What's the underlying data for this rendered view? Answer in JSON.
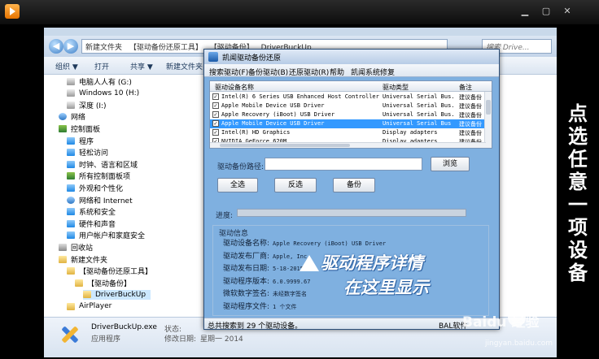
{
  "explorer": {
    "breadcrumb": [
      "新建文件夹",
      "【驱动备份还原工具】",
      "【驱动备份】",
      "DriverBuckUp"
    ],
    "search_placeholder": "搜索 Drive...",
    "toolbar": [
      "组织 ▼",
      "打开",
      "共享 ▼",
      "新建文件夹"
    ],
    "tree": [
      {
        "label": "电脑人人有 (G:)",
        "icon": "drive-icon",
        "indent": 1
      },
      {
        "label": "Windows 10 (H:)",
        "icon": "drive-icon",
        "indent": 1
      },
      {
        "label": "深度 (I:)",
        "icon": "drive-icon",
        "indent": 1
      },
      {
        "label": "网络",
        "icon": "network-icon",
        "indent": 0
      },
      {
        "label": "控制面板",
        "icon": "control-panel-icon",
        "indent": 0
      },
      {
        "label": "程序",
        "icon": "program-icon",
        "indent": 1
      },
      {
        "label": "轻松访问",
        "icon": "access-icon",
        "indent": 1
      },
      {
        "label": "时钟、语言和区域",
        "icon": "clock-icon",
        "indent": 1
      },
      {
        "label": "所有控制面板项",
        "icon": "control-panel-icon",
        "indent": 1
      },
      {
        "label": "外观和个性化",
        "icon": "appearance-icon",
        "indent": 1
      },
      {
        "label": "网络和 Internet",
        "icon": "network-icon",
        "indent": 1
      },
      {
        "label": "系统和安全",
        "icon": "security-icon",
        "indent": 1
      },
      {
        "label": "硬件和声音",
        "icon": "hardware-icon",
        "indent": 1
      },
      {
        "label": "用户帐户和家庭安全",
        "icon": "user-icon",
        "indent": 1
      },
      {
        "label": "回收站",
        "icon": "recycle-bin-icon",
        "indent": 0
      },
      {
        "label": "新建文件夹",
        "icon": "folder-icon",
        "indent": 0
      },
      {
        "label": "【驱动备份还原工具】",
        "icon": "folder-icon",
        "indent": 1
      },
      {
        "label": "【驱动备份】",
        "icon": "folder-icon",
        "indent": 2
      },
      {
        "label": "DriverBuckUp",
        "icon": "folder-icon",
        "indent": 3
      },
      {
        "label": "AirPlayer",
        "icon": "folder-icon",
        "indent": 1
      }
    ],
    "details": {
      "filename": "DriverBuckUp.exe",
      "type": "应用程序",
      "state_label": "状态:",
      "modified_label": "修改日期:",
      "modified_value": "星期一 2014"
    }
  },
  "app": {
    "title": "凯闻驱动备份还原",
    "menu": [
      "搜索驱动(F)",
      "备份驱动(B)",
      "还原驱动(R)",
      "帮助",
      "凯闻系统修复"
    ],
    "columns": [
      "驱动设备名称",
      "驱动类型",
      "备注"
    ],
    "rows": [
      {
        "name": "Intel(R) 6 Series USB Enhanced Host Controller...",
        "type": "Universal Serial Bus...",
        "note": "建议备份",
        "checked": true,
        "selected": false
      },
      {
        "name": "Apple Mobile Device USB Driver",
        "type": "Universal Serial Bus...",
        "note": "建议备份",
        "checked": true,
        "selected": false
      },
      {
        "name": "Apple Recovery (iBoot) USB Driver",
        "type": "Universal Serial Bus...",
        "note": "建议备份",
        "checked": true,
        "selected": false
      },
      {
        "name": "Apple Mobile Device USB Driver",
        "type": "Universal Serial Bus",
        "note": "建议备份",
        "checked": true,
        "selected": true
      },
      {
        "name": "Intel(R) HD Graphics",
        "type": "Display adapters",
        "note": "建议备份",
        "checked": true,
        "selected": false
      },
      {
        "name": "NVIDIA GeForce 620M",
        "type": "Display adapters",
        "note": "建议备份",
        "checked": true,
        "selected": false
      }
    ],
    "path_label": "驱动备份路径:",
    "browse": "浏览",
    "select_all": "全选",
    "invert": "反选",
    "backup": "备份",
    "progress_label": "进度:",
    "progress": 0,
    "info_title": "驱动信息",
    "info": [
      {
        "label": "驱动设备名称:",
        "value": "Apple Recovery (iBoot) USB Driver"
      },
      {
        "label": "驱动发布厂商:",
        "value": "Apple, Inc."
      },
      {
        "label": "驱动发布日期:",
        "value": "5-18-2015"
      },
      {
        "label": "驱动程序版本:",
        "value": "6.0.9999.67"
      },
      {
        "label": "微软数字签名:",
        "value": "未经数字签名"
      },
      {
        "label": "驱动程序文件:",
        "value": "1 个文件"
      }
    ],
    "status": "总共搜索到 29 个驱动设备。",
    "status_right": "BAL软件"
  },
  "overlay": {
    "annotation_line1": "驱动程序详情",
    "annotation_line2": "在这里显示",
    "vertical_chars": [
      "点",
      "选",
      "任",
      "意",
      "一",
      "项",
      "设",
      "备"
    ],
    "watermark": "Baidu 经验",
    "watermark_sub": "jingyan.baidu.com"
  }
}
